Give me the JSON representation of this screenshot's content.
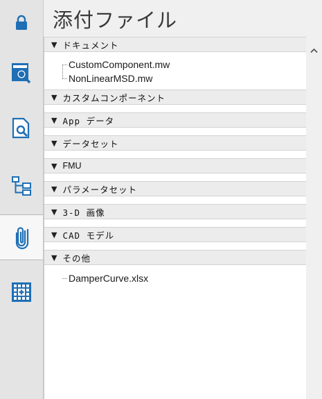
{
  "header": {
    "title": "添付ファイル"
  },
  "rail": {
    "tabs": [
      {
        "icon": "lock-icon",
        "active": false
      },
      {
        "icon": "library-search-icon",
        "active": false
      },
      {
        "icon": "document-preview-icon",
        "active": false
      },
      {
        "icon": "hierarchy-tree-icon",
        "active": false
      },
      {
        "icon": "paperclip-icon",
        "active": true
      },
      {
        "icon": "grid-table-icon",
        "active": false
      }
    ]
  },
  "sections": [
    {
      "label": "ドキュメント",
      "files": [
        "CustomComponent.mw",
        "NonLinearMSD.mw"
      ]
    },
    {
      "label": "カスタムコンポーネント",
      "files": []
    },
    {
      "label": "App データ",
      "files": []
    },
    {
      "label": "データセット",
      "files": []
    },
    {
      "label": "FMU",
      "files": []
    },
    {
      "label": "パラメータセット",
      "files": []
    },
    {
      "label": "3-D 画像",
      "files": []
    },
    {
      "label": "CAD モデル",
      "files": []
    },
    {
      "label": "その他",
      "files": [
        "DamperCurve.xlsx"
      ]
    }
  ],
  "expander_glyph": "▼",
  "colors": {
    "accent": "#1e6fb5",
    "section_bg": "#ececec",
    "panel_bg": "#ffffff"
  }
}
